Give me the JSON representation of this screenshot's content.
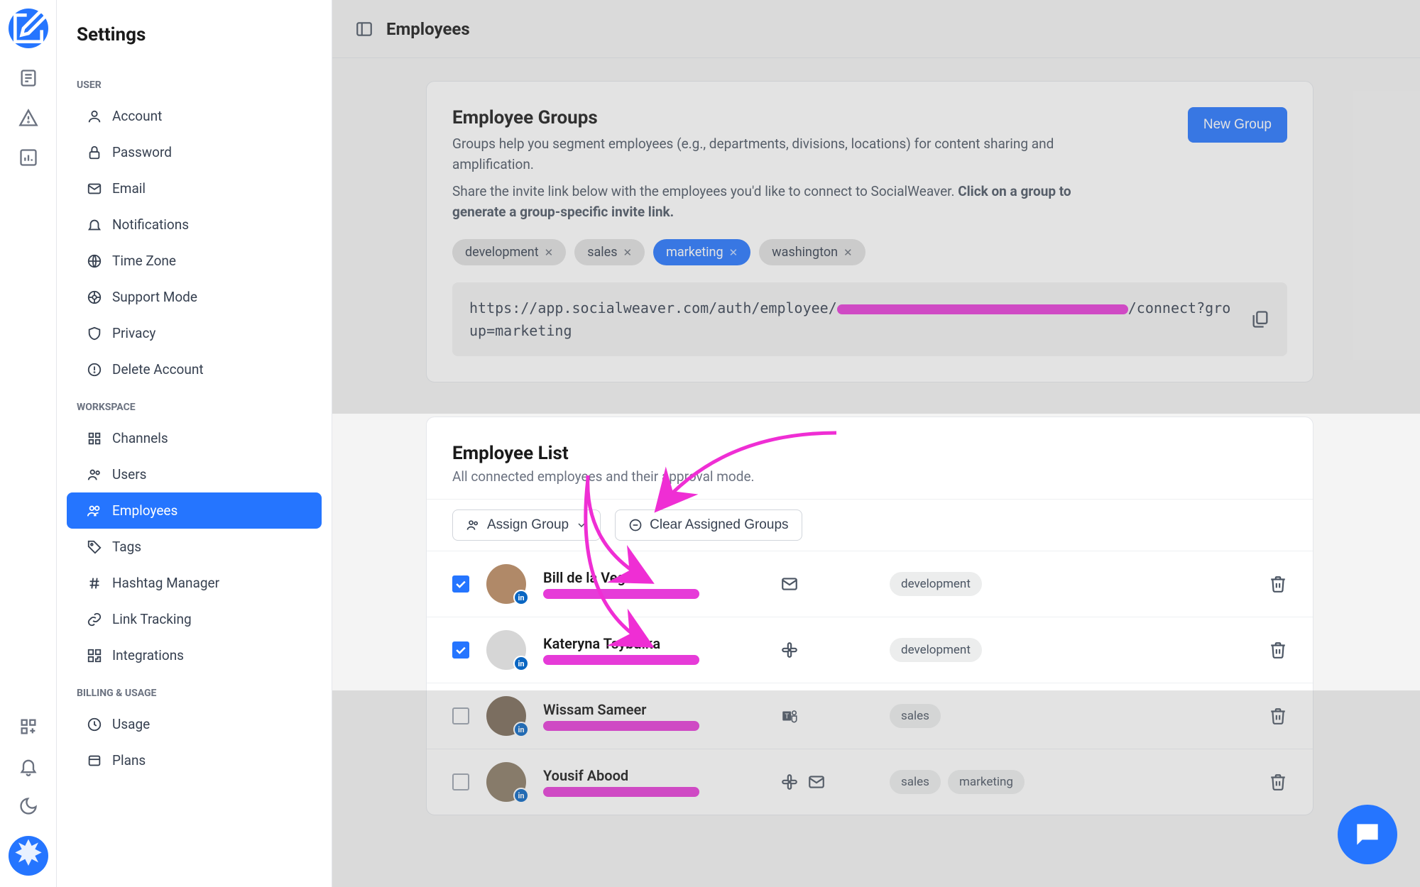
{
  "sidebar_title": "Settings",
  "page_title": "Employees",
  "sections": {
    "user": {
      "label": "USER",
      "items": [
        "Account",
        "Password",
        "Email",
        "Notifications",
        "Time Zone",
        "Support Mode",
        "Privacy",
        "Delete Account"
      ]
    },
    "workspace": {
      "label": "WORKSPACE",
      "items": [
        "Channels",
        "Users",
        "Employees",
        "Tags",
        "Hashtag Manager",
        "Link Tracking",
        "Integrations"
      ],
      "active_index": 2
    },
    "billing": {
      "label": "BILLING & USAGE",
      "items": [
        "Usage",
        "Plans"
      ]
    }
  },
  "groups": {
    "title": "Employee Groups",
    "desc": "Groups help you segment employees (e.g., departments, divisions, locations) for content sharing and amplification.",
    "desc2_a": "Share the invite link below with the employees you'd like to connect to SocialWeaver. ",
    "desc2_b": "Click on a group to generate a group-specific invite link.",
    "new_btn": "New Group",
    "chips": [
      {
        "label": "development",
        "active": false
      },
      {
        "label": "sales",
        "active": false
      },
      {
        "label": "marketing",
        "active": true
      },
      {
        "label": "washington",
        "active": false
      }
    ],
    "link_a": "https://app.socialweaver.com/auth/employee/",
    "link_b": "/connect?group=marketing"
  },
  "list": {
    "title": "Employee List",
    "sub": "All connected employees and their approval mode.",
    "assign": "Assign Group",
    "clear": "Clear Assigned Groups",
    "rows": [
      {
        "name": "Bill de la Vega",
        "checked": true,
        "icons": [
          "mail"
        ],
        "tags": [
          "development"
        ]
      },
      {
        "name": "Kateryna Tsybulka",
        "checked": true,
        "icons": [
          "slack"
        ],
        "tags": [
          "development"
        ]
      },
      {
        "name": "Wissam Sameer",
        "checked": false,
        "icons": [
          "teams"
        ],
        "tags": [
          "sales"
        ]
      },
      {
        "name": "Yousif Abood",
        "checked": false,
        "icons": [
          "slack",
          "mail"
        ],
        "tags": [
          "sales",
          "marketing"
        ]
      }
    ]
  }
}
